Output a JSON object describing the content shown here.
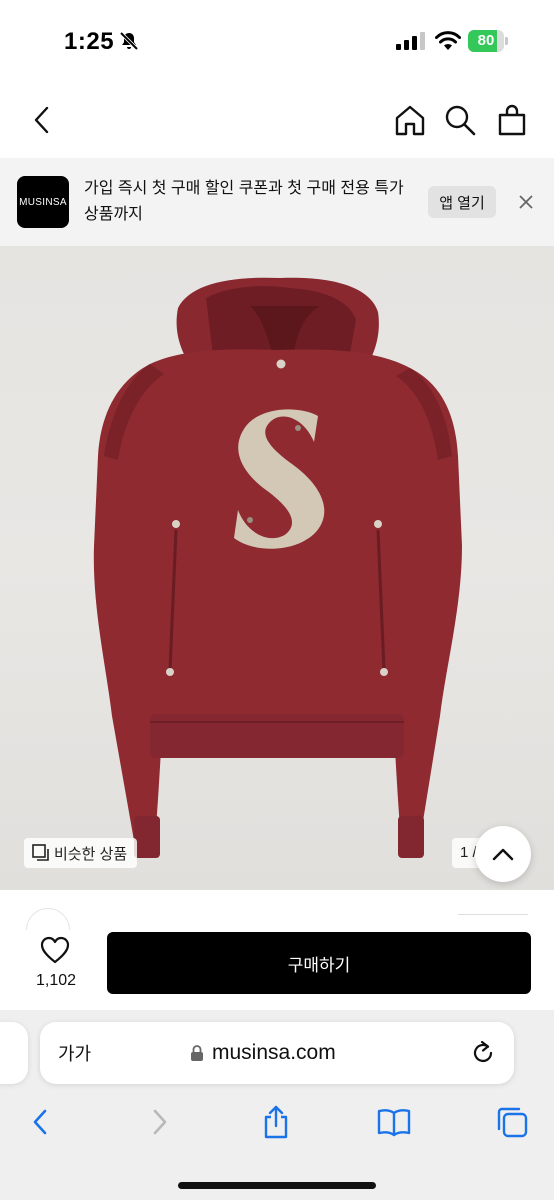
{
  "status_bar": {
    "time": "1:25",
    "battery_level": "80",
    "battery_fraction": 0.8
  },
  "nav": {
    "icons": [
      "chevron-left-icon",
      "home-icon",
      "search-icon",
      "shopping-bag-icon"
    ]
  },
  "app_banner": {
    "logo_text": "MUSINSA",
    "message": "가입 즉시 첫 구매 할인 쿠폰과 첫 구매 전용 특가 상품까지",
    "open_label": "앱 열기"
  },
  "product": {
    "similar_label": "비슷한 상품",
    "page_counter": "1 /",
    "image_colors": {
      "hoodie": "#8e2a30",
      "letter_patch": "#d3c7b6",
      "background": "#e6e4e1"
    }
  },
  "purchase": {
    "like_count": "1,102",
    "buy_label": "구매하기"
  },
  "browser": {
    "text_size_label": "가가",
    "url": "musinsa.com"
  },
  "colors": {
    "accent": "#000000",
    "battery_green": "#34c759",
    "ios_blue": "#1a73e8"
  }
}
